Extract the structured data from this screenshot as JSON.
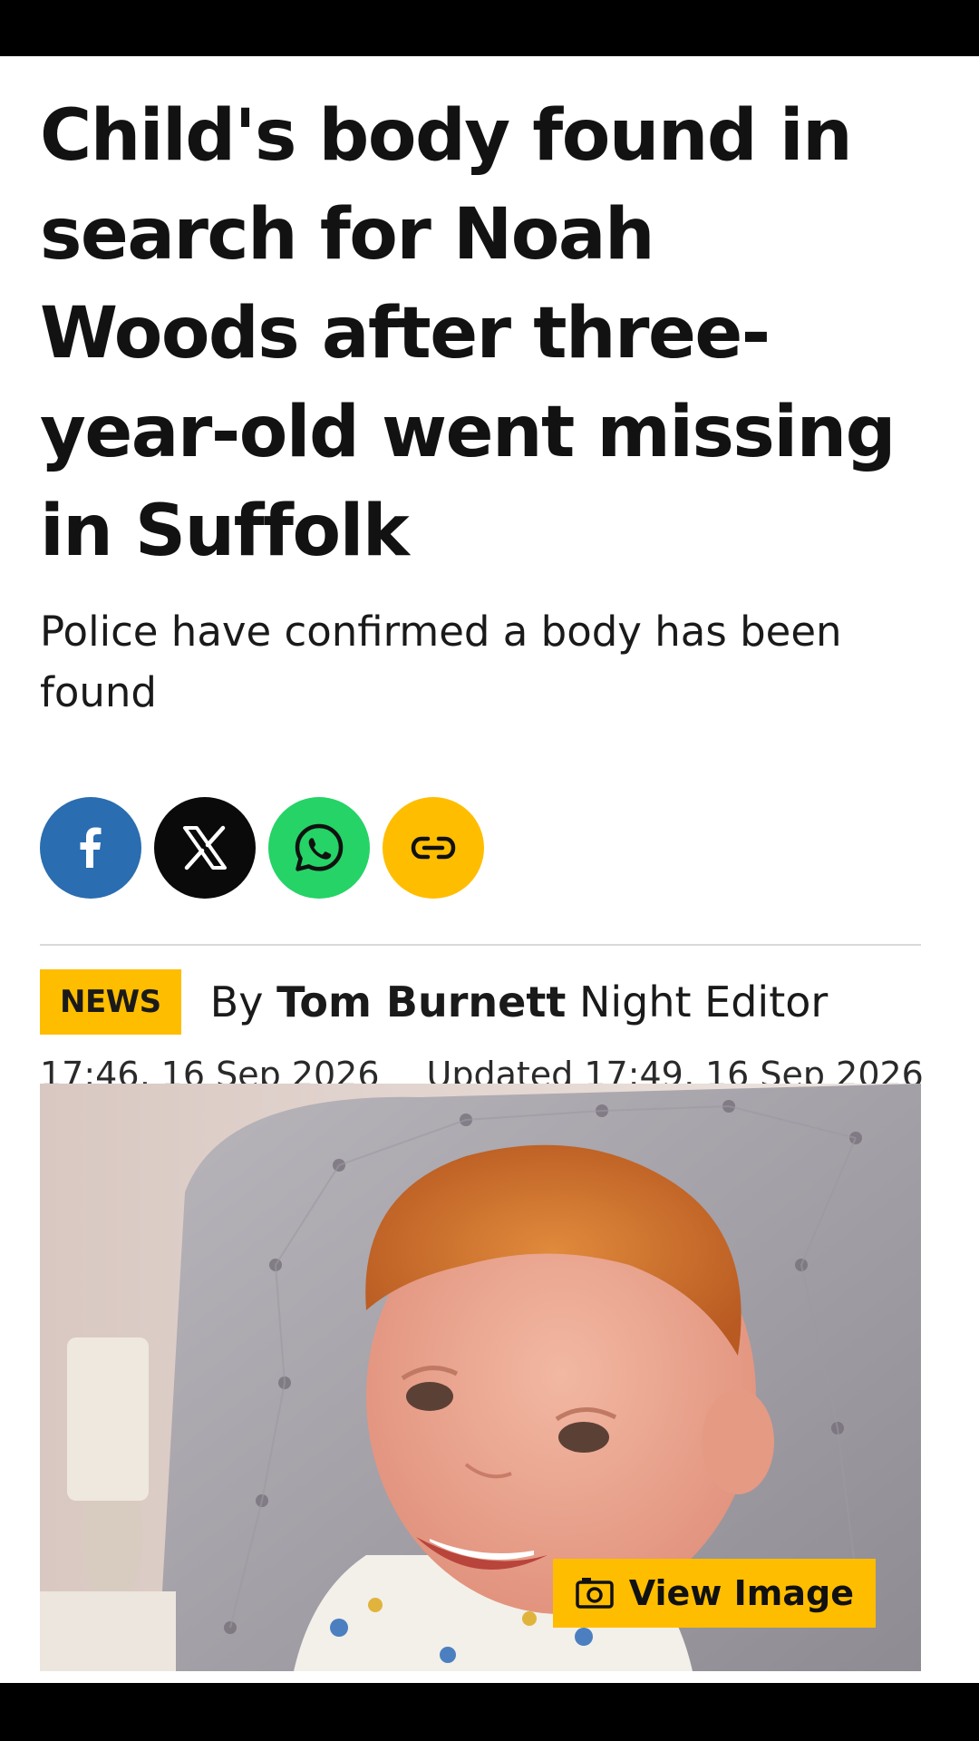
{
  "article": {
    "headline": "Child's body found in search for Noah Woods after three-year-old went missing in Suffolk",
    "standfirst": "Police have confirmed a body has been found"
  },
  "share": {
    "buttons": [
      {
        "name": "facebook",
        "icon": "facebook-icon",
        "color": "#2a6db0"
      },
      {
        "name": "x",
        "icon": "x-icon",
        "color": "#0a0a0a"
      },
      {
        "name": "whatsapp",
        "icon": "whatsapp-icon",
        "color": "#25d366"
      },
      {
        "name": "copy-link",
        "icon": "link-icon",
        "color": "#ffbd00"
      }
    ]
  },
  "meta": {
    "category": "NEWS",
    "by_prefix": "By",
    "author": "Tom Burnett",
    "role": "Night Editor",
    "published": "17:46, 16 Sep 2026",
    "updated": "Updated 17:49, 16 Sep 2026"
  },
  "hero": {
    "view_label": "View Image",
    "view_icon": "camera-icon"
  },
  "colors": {
    "accent": "#ffbd00",
    "text": "#121212"
  }
}
